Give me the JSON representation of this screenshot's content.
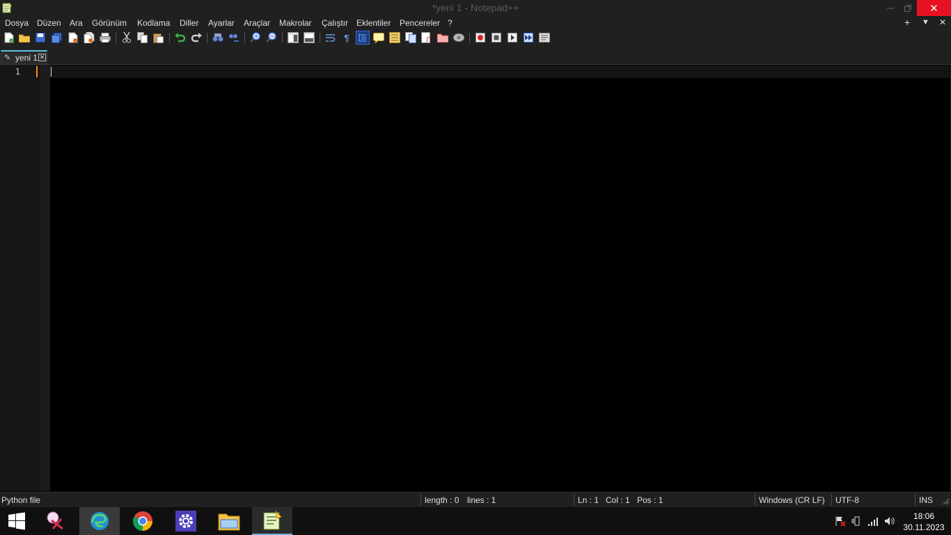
{
  "window": {
    "title": "*yeni 1 - Notepad++",
    "minimize_icon": "minimize-icon",
    "maximize_icon": "restore-icon",
    "close_label": "✕"
  },
  "menu": {
    "items": [
      "Dosya",
      "Düzen",
      "Ara",
      "Görünüm",
      "Kodlama",
      "Diller",
      "Ayarlar",
      "Araçlar",
      "Makrolar",
      "Çalıştır",
      "Eklentiler",
      "Pencereler",
      "?"
    ],
    "right": [
      "+",
      "▼",
      "✕"
    ]
  },
  "toolbar": {
    "buttons": [
      "new-file",
      "open-file",
      "save",
      "save-all",
      "close",
      "close-all",
      "print",
      "cut",
      "copy",
      "paste",
      "undo",
      "redo",
      "find",
      "replace",
      "zoom-in",
      "zoom-out",
      "sync-vertical",
      "sync-horizontal",
      "word-wrap",
      "show-all-chars",
      "indent-guide",
      "user-defined-language",
      "document-map",
      "document-list",
      "function-list",
      "folder-as-workspace",
      "monitoring",
      "record-macro",
      "stop-recording",
      "play-macro",
      "run-macro-multiple",
      "save-macro"
    ],
    "active_button": "indent-guide"
  },
  "tabs": [
    {
      "label": "yeni 1",
      "modified": true,
      "close_glyph": "✕"
    }
  ],
  "editor": {
    "line_numbers": [
      "1"
    ],
    "content": ""
  },
  "statusbar": {
    "language": "Python file",
    "length": "length : 0",
    "lines": "lines : 1",
    "ln": "Ln : 1",
    "col": "Col : 1",
    "pos": "Pos : 1",
    "eol": "Windows (CR LF)",
    "encoding": "UTF-8",
    "mode": "INS"
  },
  "taskbar": {
    "apps": [
      "start",
      "snipping-tool",
      "edge",
      "chrome",
      "settings",
      "file-explorer",
      "notepad-plus-plus"
    ],
    "active_app": "notepad-plus-plus",
    "time": "18:06",
    "date": "30.11.2023"
  },
  "colors": {
    "accent_tab": "#5ac3e8",
    "change_marker": "#ff8c1a",
    "close_red": "#e81123",
    "background": "#000000"
  }
}
